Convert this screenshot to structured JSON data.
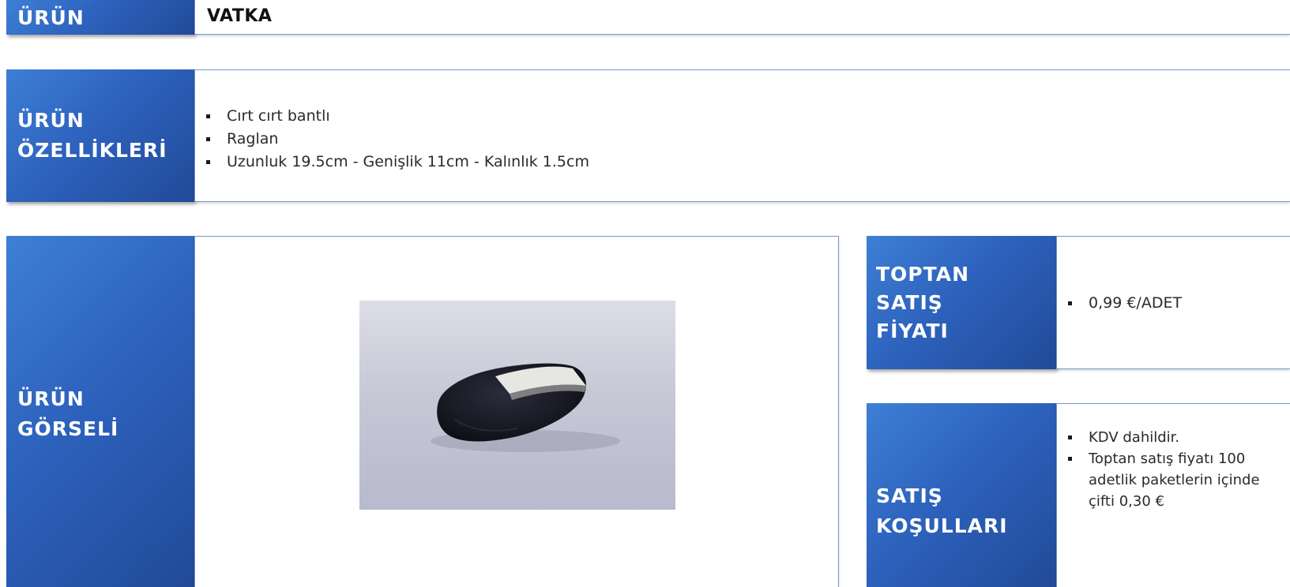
{
  "product": {
    "label": "ÜRÜN",
    "value": "VATKA"
  },
  "features": {
    "label_line1": "ÜRÜN",
    "label_line2": "ÖZELLİKLERİ",
    "items": [
      "Cırt cırt bantlı",
      "Raglan",
      "Uzunluk 19.5cm - Genişlik 11cm - Kalınlık 1.5cm"
    ]
  },
  "image": {
    "label_line1": "ÜRÜN",
    "label_line2": "GÖRSELİ",
    "photo_icon": "shoulder-pad-photo"
  },
  "price": {
    "label_line1": "TOPTAN",
    "label_line2": "SATIŞ",
    "label_line3": "FİYATI",
    "items": [
      "0,99 €/ADET"
    ]
  },
  "terms": {
    "label_line1": "SATIŞ",
    "label_line2": "KOŞULLARI",
    "items": [
      "KDV dahildir.",
      "Toptan satış fiyatı 100 adetlik paketlerin içinde çifti 0,30 €"
    ]
  },
  "colors": {
    "header_gradient_start": "#3e7fd6",
    "header_gradient_end": "#214a98",
    "box_border": "#7a95c9"
  }
}
